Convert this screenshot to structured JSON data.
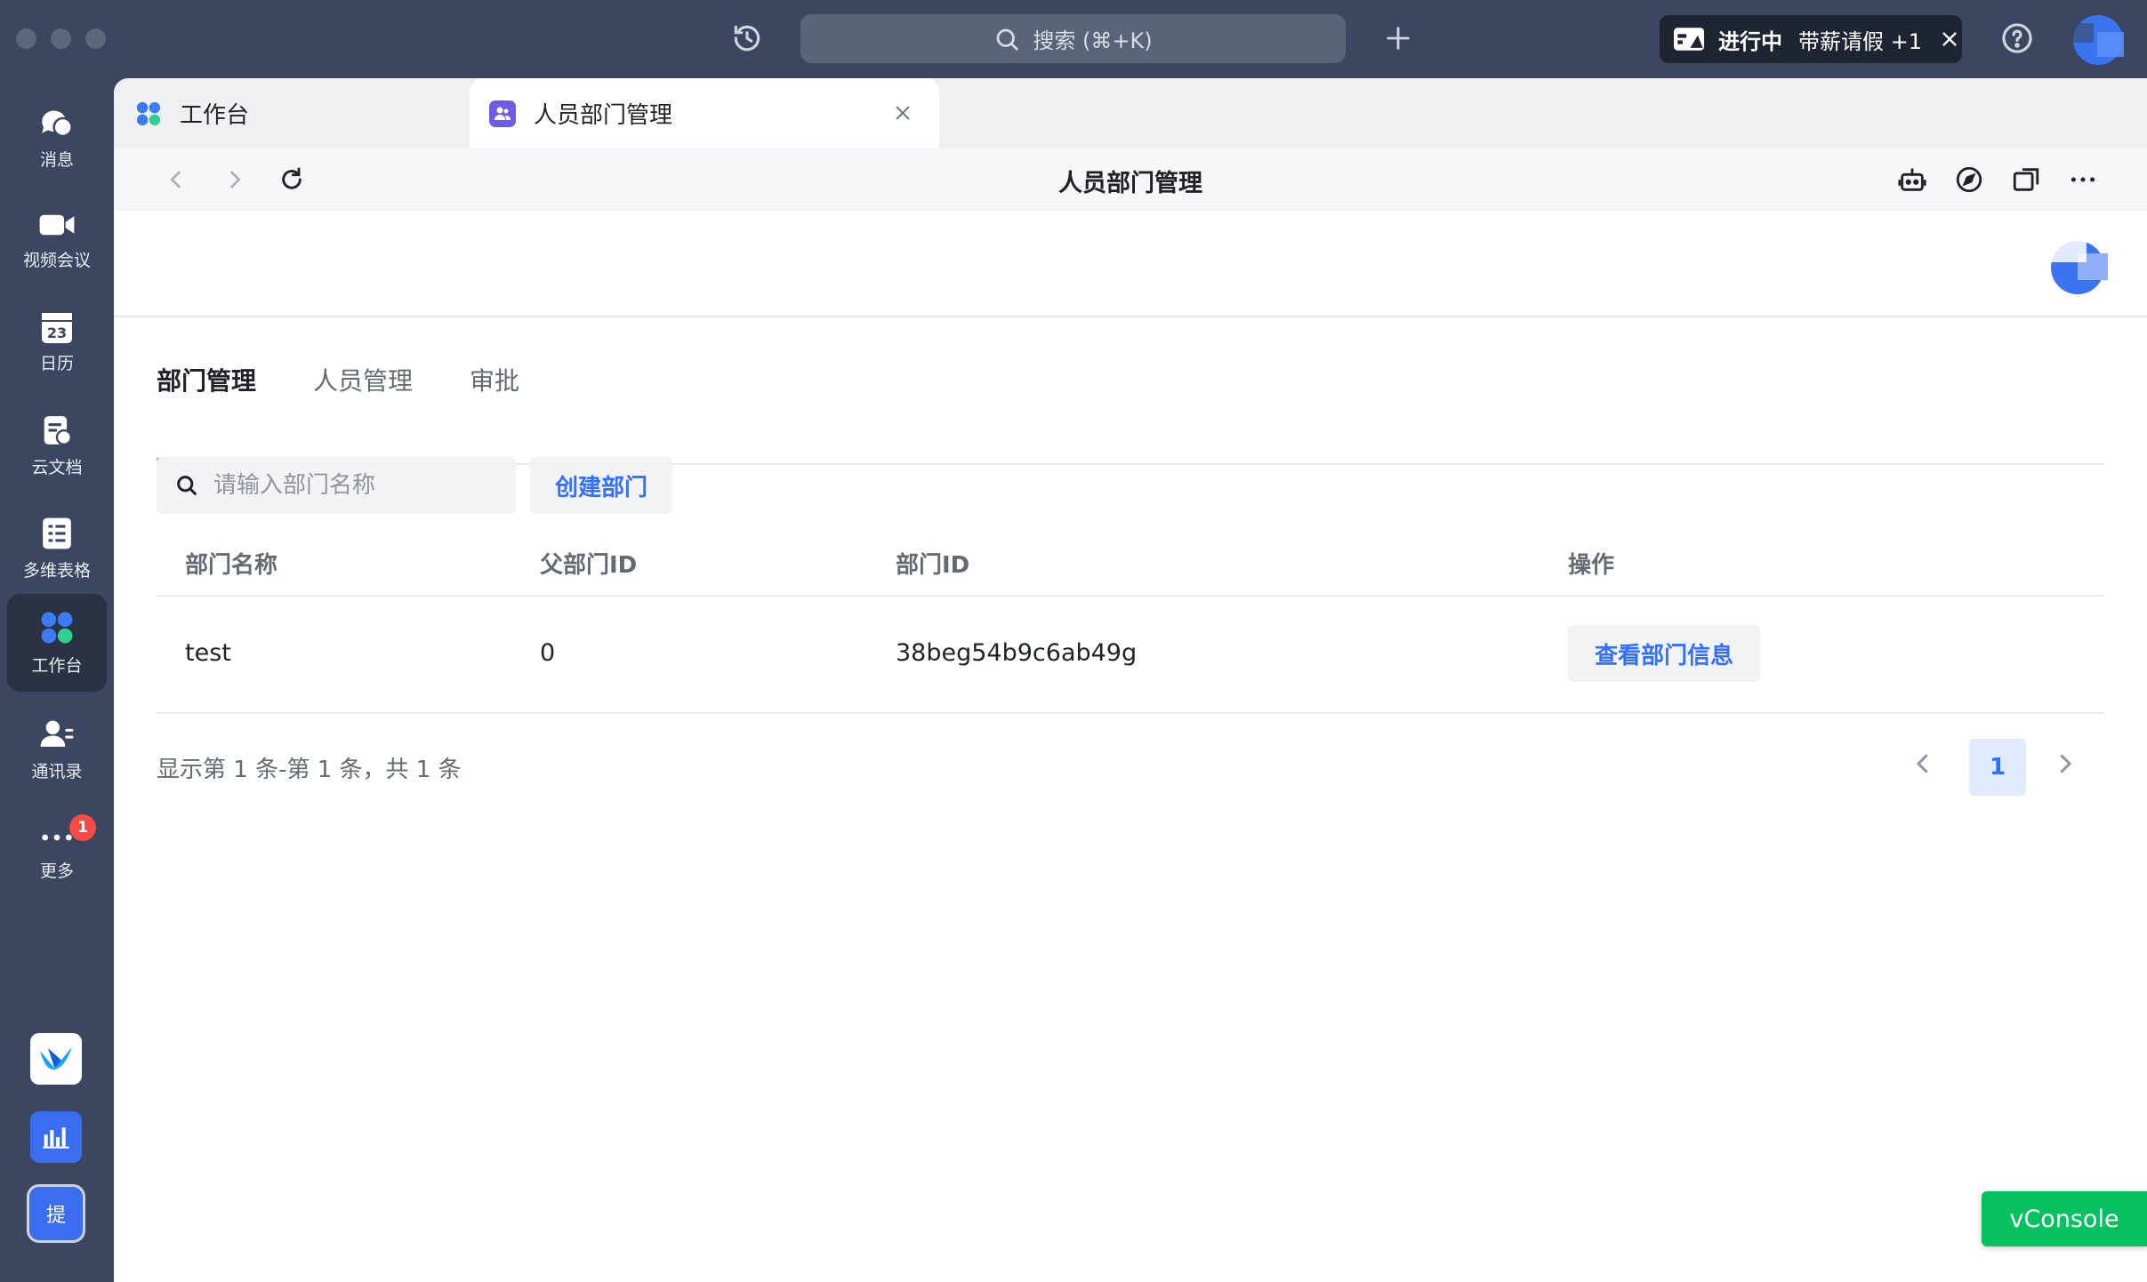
{
  "topbar": {
    "search_placeholder": "搜索 (⌘+K)",
    "status_label": "进行中",
    "status_detail": "带薪请假 +1"
  },
  "nav": {
    "items": [
      {
        "label": "消息",
        "icon": "chat-icon"
      },
      {
        "label": "视频会议",
        "icon": "video-icon"
      },
      {
        "label": "日历",
        "icon": "calendar-icon",
        "day": "23"
      },
      {
        "label": "云文档",
        "icon": "doc-icon"
      },
      {
        "label": "多维表格",
        "icon": "sheet-icon"
      },
      {
        "label": "工作台",
        "icon": "workbench-icon",
        "active": true
      },
      {
        "label": "通讯录",
        "icon": "contacts-icon"
      },
      {
        "label": "更多",
        "icon": "more-icon",
        "badge": "1"
      }
    ],
    "bottom_app_label": "提"
  },
  "browser_tabs": [
    {
      "label": "工作台"
    },
    {
      "label": "人员部门管理",
      "active": true
    }
  ],
  "toolbar": {
    "title": "人员部门管理"
  },
  "page": {
    "tabs": [
      "部门管理",
      "人员管理",
      "审批"
    ],
    "active_tab": 0,
    "search_placeholder": "请输入部门名称",
    "create_button": "创建部门",
    "table": {
      "columns": [
        "部门名称",
        "父部门ID",
        "部门ID",
        "操作"
      ],
      "rows": [
        {
          "name": "test",
          "parent_id": "0",
          "dept_id": "38beg54b9c6ab49g",
          "action": "查看部门信息"
        }
      ]
    },
    "summary": "显示第 1 条-第 1 条，共 1 条",
    "current_page": "1"
  },
  "vconsole_label": "vConsole",
  "colors": {
    "accent": "#3370ff",
    "sidebar": "#3b4760",
    "vconsole": "#07c160"
  }
}
